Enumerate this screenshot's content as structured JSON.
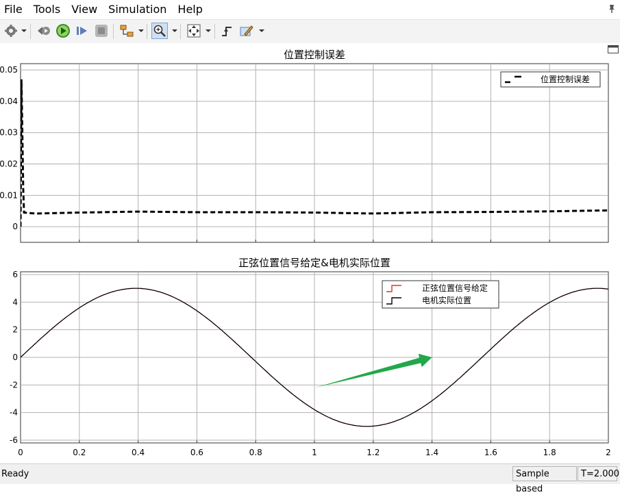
{
  "menubar": {
    "items": [
      {
        "label": "File"
      },
      {
        "label": "Tools"
      },
      {
        "label": "View"
      },
      {
        "label": "Simulation"
      },
      {
        "label": "Help"
      }
    ]
  },
  "toolbar": {
    "icons": [
      "gear-icon",
      "step-back-icon",
      "run-icon",
      "step-forward-icon",
      "stop-icon",
      "highlight-signal-icon",
      "zoom-icon",
      "fit-to-view-icon",
      "trigger-icon",
      "style-icon"
    ],
    "active": "zoom-icon"
  },
  "statusbar": {
    "ready": "Ready",
    "mode": "Sample based",
    "time": "T=2.000"
  },
  "chart_data": [
    {
      "type": "line",
      "title": "位置控制误差",
      "xlim": [
        0,
        2
      ],
      "ylim": [
        -0.005,
        0.052
      ],
      "yticks": [
        "0",
        "0.01",
        "0.02",
        "0.03",
        "0.04",
        "0.05"
      ],
      "ytick_values": [
        0,
        0.01,
        0.02,
        0.03,
        0.04,
        0.05
      ],
      "xticks": [
        0,
        0.2,
        0.4,
        0.6,
        0.8,
        1.0,
        1.2,
        1.4,
        1.6,
        1.8,
        2.0
      ],
      "xtick_labels_shown": false,
      "grid": true,
      "legend": {
        "position": "top-right"
      },
      "series": [
        {
          "name": "位置控制误差",
          "color": "#000000",
          "style": "dashed",
          "x": [
            0,
            0.003,
            0.006,
            0.009,
            0.012,
            0.05,
            0.2,
            0.4,
            0.6,
            0.8,
            1.0,
            1.2,
            1.4,
            1.6,
            1.8,
            2.0
          ],
          "y": [
            0,
            0.047,
            0.03,
            0.012,
            0.0045,
            0.0042,
            0.0045,
            0.0048,
            0.0046,
            0.0046,
            0.0045,
            0.0042,
            0.0046,
            0.0047,
            0.0049,
            0.0052
          ]
        }
      ]
    },
    {
      "type": "line",
      "title": "正弦位置信号给定&电机实际位置",
      "xlim": [
        0,
        2
      ],
      "ylim": [
        -6.2,
        6.2
      ],
      "yticks": [
        "-6",
        "-4",
        "-2",
        "0",
        "2",
        "4",
        "6"
      ],
      "ytick_values": [
        -6,
        -4,
        -2,
        0,
        2,
        4,
        6
      ],
      "xticks": [
        "0",
        "0.2",
        "0.4",
        "0.6",
        "0.8",
        "1",
        "1.2",
        "1.4",
        "1.6",
        "1.8",
        "2"
      ],
      "xtick_values": [
        0,
        0.2,
        0.4,
        0.6,
        0.8,
        1.0,
        1.2,
        1.4,
        1.6,
        1.8,
        2.0
      ],
      "grid": true,
      "legend": {
        "position": "top-right"
      },
      "series": [
        {
          "name": "正弦位置信号给定",
          "color": "#e03030",
          "style": "solid",
          "amplitude": 5,
          "period": 1.57
        },
        {
          "name": "电机实际位置",
          "color": "#000000",
          "style": "solid",
          "amplitude": 5,
          "period": 1.57
        }
      ],
      "annotation": {
        "type": "arrow",
        "color": "#22a84a",
        "from": [
          1.0,
          -2.2
        ],
        "to": [
          1.4,
          0.0
        ]
      }
    }
  ]
}
